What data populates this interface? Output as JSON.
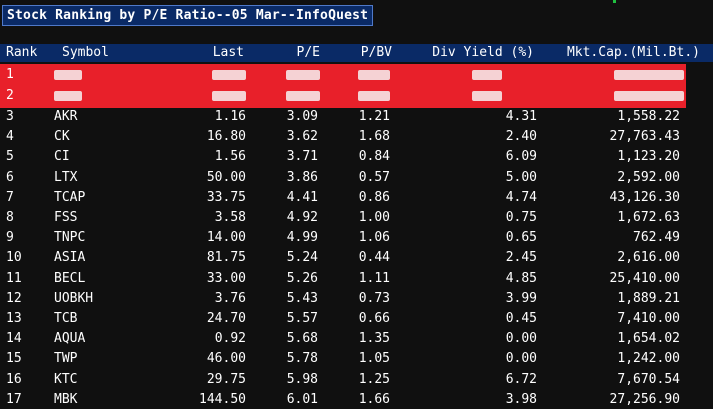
{
  "title": "Stock Ranking by P/E Ratio--05 Mar--InfoQuest",
  "columns": {
    "rank": "Rank",
    "symbol": "Symbol",
    "last": "Last",
    "pe": "P/E",
    "pbv": "P/BV",
    "div_yield": "Div Yield (%)",
    "mkt_cap": "Mkt.Cap.(Mil.Bt.)"
  },
  "redacted_rows": [
    {
      "rank": "1"
    },
    {
      "rank": "2"
    }
  ],
  "rows": [
    {
      "rank": "3",
      "symbol": "AKR",
      "last": "1.16",
      "pe": "3.09",
      "pbv": "1.21",
      "div_yield": "4.31",
      "mkt_cap": "1,558.22"
    },
    {
      "rank": "4",
      "symbol": "CK",
      "last": "16.80",
      "pe": "3.62",
      "pbv": "1.68",
      "div_yield": "2.40",
      "mkt_cap": "27,763.43"
    },
    {
      "rank": "5",
      "symbol": "CI",
      "last": "1.56",
      "pe": "3.71",
      "pbv": "0.84",
      "div_yield": "6.09",
      "mkt_cap": "1,123.20"
    },
    {
      "rank": "6",
      "symbol": "LTX",
      "last": "50.00",
      "pe": "3.86",
      "pbv": "0.57",
      "div_yield": "5.00",
      "mkt_cap": "2,592.00"
    },
    {
      "rank": "7",
      "symbol": "TCAP",
      "last": "33.75",
      "pe": "4.41",
      "pbv": "0.86",
      "div_yield": "4.74",
      "mkt_cap": "43,126.30"
    },
    {
      "rank": "8",
      "symbol": "FSS",
      "last": "3.58",
      "pe": "4.92",
      "pbv": "1.00",
      "div_yield": "0.75",
      "mkt_cap": "1,672.63"
    },
    {
      "rank": "9",
      "symbol": "TNPC",
      "last": "14.00",
      "pe": "4.99",
      "pbv": "1.06",
      "div_yield": "0.65",
      "mkt_cap": "762.49"
    },
    {
      "rank": "10",
      "symbol": "ASIA",
      "last": "81.75",
      "pe": "5.24",
      "pbv": "0.44",
      "div_yield": "2.45",
      "mkt_cap": "2,616.00"
    },
    {
      "rank": "11",
      "symbol": "BECL",
      "last": "33.00",
      "pe": "5.26",
      "pbv": "1.11",
      "div_yield": "4.85",
      "mkt_cap": "25,410.00"
    },
    {
      "rank": "12",
      "symbol": "UOBKH",
      "last": "3.76",
      "pe": "5.43",
      "pbv": "0.73",
      "div_yield": "3.99",
      "mkt_cap": "1,889.21"
    },
    {
      "rank": "13",
      "symbol": "TCB",
      "last": "24.70",
      "pe": "5.57",
      "pbv": "0.66",
      "div_yield": "0.45",
      "mkt_cap": "7,410.00"
    },
    {
      "rank": "14",
      "symbol": "AQUA",
      "last": "0.92",
      "pe": "5.68",
      "pbv": "1.35",
      "div_yield": "0.00",
      "mkt_cap": "1,654.02"
    },
    {
      "rank": "15",
      "symbol": "TWP",
      "last": "46.00",
      "pe": "5.78",
      "pbv": "1.05",
      "div_yield": "0.00",
      "mkt_cap": "1,242.00"
    },
    {
      "rank": "16",
      "symbol": "KTC",
      "last": "29.75",
      "pe": "5.98",
      "pbv": "1.25",
      "div_yield": "6.72",
      "mkt_cap": "7,670.54"
    },
    {
      "rank": "17",
      "symbol": "MBK",
      "last": "144.50",
      "pe": "6.01",
      "pbv": "1.66",
      "div_yield": "3.98",
      "mkt_cap": "27,256.90"
    }
  ],
  "colors": {
    "background": "#101010",
    "header_bg": "#0a2a66",
    "redaction_red": "#e8202a"
  }
}
